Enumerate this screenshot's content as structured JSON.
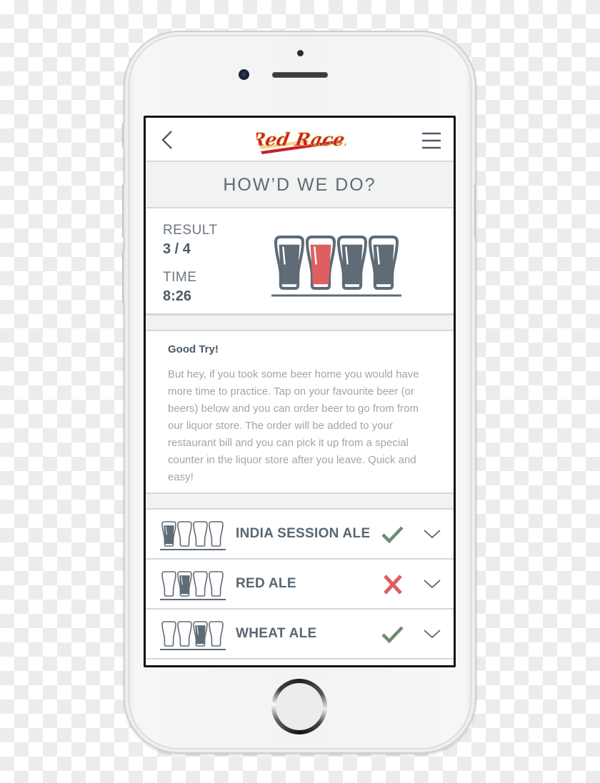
{
  "app": {
    "brand": "Red Racer",
    "brand_colors": {
      "red": "#c8202a",
      "gold": "#e8b84a"
    }
  },
  "header": {
    "back_icon": "chevron-left-icon",
    "menu_icon": "hamburger-menu-icon"
  },
  "page": {
    "title": "HOW’D WE DO?"
  },
  "result": {
    "result_label": "RESULT",
    "result_value": "3 / 4",
    "time_label": "TIME",
    "time_value": "8:26",
    "glasses": [
      {
        "fill": "#5f6b76",
        "correct": true
      },
      {
        "fill": "#de5f5f",
        "correct": false
      },
      {
        "fill": "#5f6b76",
        "correct": true
      },
      {
        "fill": "#5f6b76",
        "correct": true
      }
    ]
  },
  "message": {
    "title": "Good Try!",
    "body": "But hey, if you took some beer home you would have more time to practice. Tap on your favourite beer (or beers) below and you can order beer to go from from our liquor store. The order will be added to your restaurant bill and you can pick it up from a special counter in the liquor store after you leave. Quick and easy!"
  },
  "beers": [
    {
      "name": "INDIA SESSION ALE",
      "position": 1,
      "status": "correct",
      "status_icon": "checkmark-icon"
    },
    {
      "name": "RED ALE",
      "position": 2,
      "status": "incorrect",
      "status_icon": "x-mark-icon"
    },
    {
      "name": "WHEAT ALE",
      "position": 3,
      "status": "correct",
      "status_icon": "checkmark-icon"
    }
  ],
  "colors": {
    "slate": "#5f6b76",
    "correct_green": "#6f8a72",
    "incorrect_red": "#de5f5f",
    "band_gray": "#f1f2f2"
  }
}
